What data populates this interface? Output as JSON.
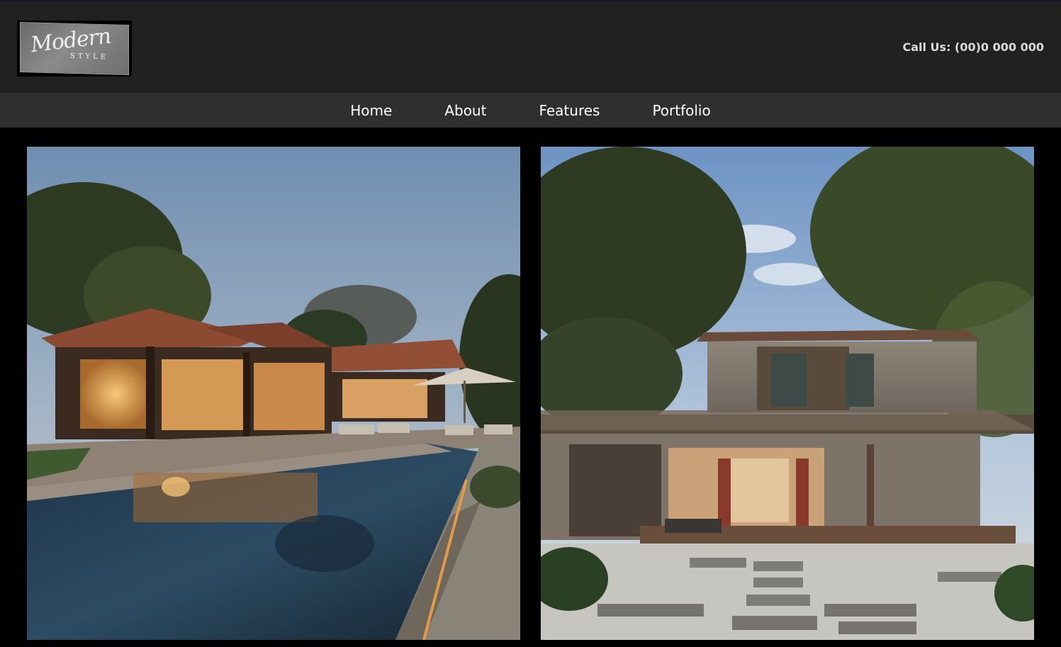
{
  "header": {
    "logo": {
      "script": "Modern",
      "sub": "STYLE"
    },
    "call_label": "Call Us: (00)0 000 000"
  },
  "nav": {
    "items": [
      {
        "label": "Home"
      },
      {
        "label": "About"
      },
      {
        "label": "Features"
      },
      {
        "label": "Portfolio"
      }
    ]
  },
  "gallery": {
    "images": [
      {
        "subject": "pool-villa-dusk-photo"
      },
      {
        "subject": "two-story-house-garden-photo"
      }
    ]
  },
  "colors": {
    "header_bg": "#212121",
    "nav_bg": "#2f2f2f",
    "page_bg": "#000000"
  }
}
